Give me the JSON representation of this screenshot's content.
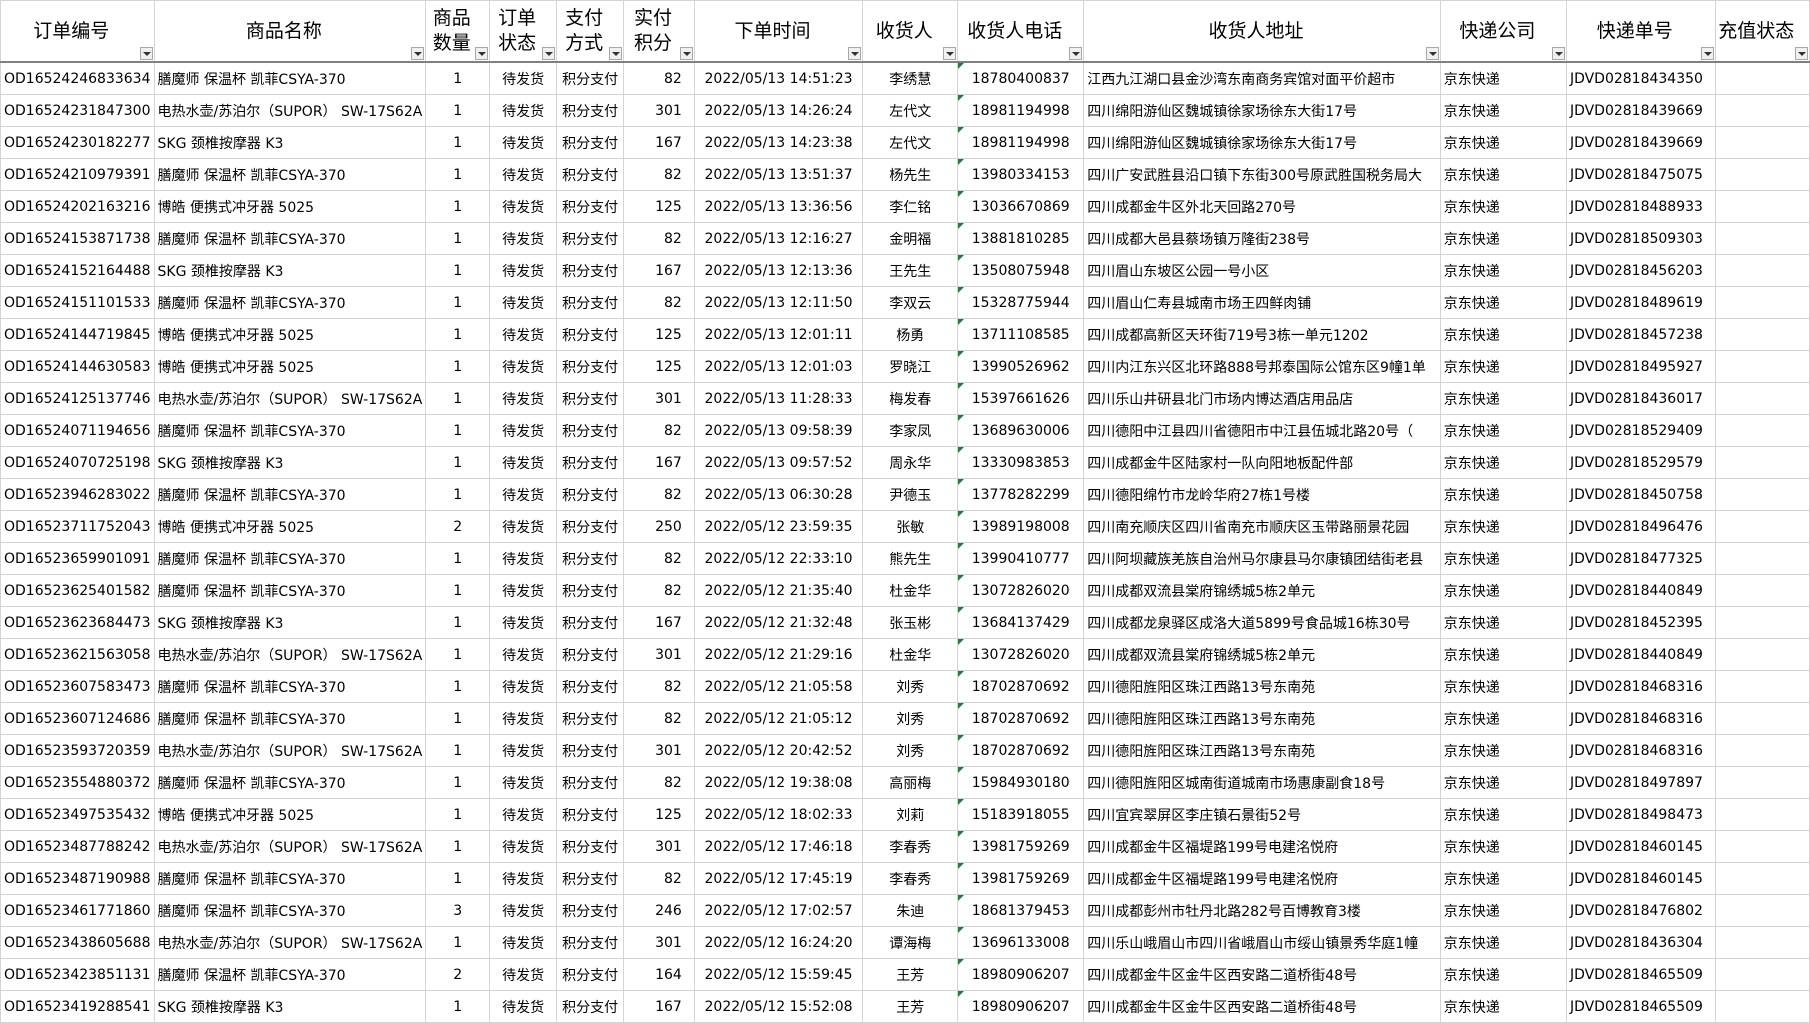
{
  "columns": [
    {
      "key": "id",
      "label": "订单编号",
      "align": "l"
    },
    {
      "key": "name",
      "label": "商品名称",
      "align": "l"
    },
    {
      "key": "qty",
      "label": "商品数量",
      "align": "c"
    },
    {
      "key": "status",
      "label": "订单状态",
      "align": "c"
    },
    {
      "key": "pay",
      "label": "支付方式",
      "align": "c"
    },
    {
      "key": "points",
      "label": "实付积分",
      "align": "r"
    },
    {
      "key": "time",
      "label": "下单时间",
      "align": "c"
    },
    {
      "key": "receiver",
      "label": "收货人",
      "align": "c"
    },
    {
      "key": "phone",
      "label": "收货人电话",
      "align": "c",
      "triangle": true
    },
    {
      "key": "addr",
      "label": "收货人地址",
      "align": "l"
    },
    {
      "key": "courier",
      "label": "快递公司",
      "align": "l"
    },
    {
      "key": "tracking",
      "label": "快递单号",
      "align": "l"
    },
    {
      "key": "recharge",
      "label": "充值状态",
      "align": "l"
    }
  ],
  "rows": [
    {
      "id": "OD16524246833634",
      "name": "膳魔师 保温杯 凯菲CSYA-370",
      "qty": "1",
      "status": "待发货",
      "pay": "积分支付",
      "points": "82",
      "time": "2022/05/13 14:51:23",
      "receiver": "李绣慧",
      "phone": "18780400837",
      "addr": "江西九江湖口县金沙湾东南商务宾馆对面平价超市",
      "courier": "京东快递",
      "tracking": "JDVD02818434350",
      "recharge": ""
    },
    {
      "id": "OD16524231847300",
      "name": "电热水壶/苏泊尔（SUPOR） SW-17S62A",
      "qty": "1",
      "status": "待发货",
      "pay": "积分支付",
      "points": "301",
      "time": "2022/05/13 14:26:24",
      "receiver": "左代文",
      "phone": "18981194998",
      "addr": "四川绵阳游仙区魏城镇徐家场徐东大街17号",
      "courier": "京东快递",
      "tracking": "JDVD02818439669",
      "recharge": ""
    },
    {
      "id": "OD16524230182277",
      "name": "SKG 颈椎按摩器 K3",
      "qty": "1",
      "status": "待发货",
      "pay": "积分支付",
      "points": "167",
      "time": "2022/05/13 14:23:38",
      "receiver": "左代文",
      "phone": "18981194998",
      "addr": "四川绵阳游仙区魏城镇徐家场徐东大街17号",
      "courier": "京东快递",
      "tracking": "JDVD02818439669",
      "recharge": ""
    },
    {
      "id": "OD16524210979391",
      "name": "膳魔师 保温杯 凯菲CSYA-370",
      "qty": "1",
      "status": "待发货",
      "pay": "积分支付",
      "points": "82",
      "time": "2022/05/13 13:51:37",
      "receiver": "杨先生",
      "phone": "13980334153",
      "addr": "四川广安武胜县沿口镇下东街300号原武胜国税务局大",
      "courier": "京东快递",
      "tracking": "JDVD02818475075",
      "recharge": ""
    },
    {
      "id": "OD16524202163216",
      "name": "博皓 便携式冲牙器 5025",
      "qty": "1",
      "status": "待发货",
      "pay": "积分支付",
      "points": "125",
      "time": "2022/05/13 13:36:56",
      "receiver": "李仁铭",
      "phone": "13036670869",
      "addr": "四川成都金牛区外北天回路270号",
      "courier": "京东快递",
      "tracking": "JDVD02818488933",
      "recharge": ""
    },
    {
      "id": "OD16524153871738",
      "name": "膳魔师 保温杯 凯菲CSYA-370",
      "qty": "1",
      "status": "待发货",
      "pay": "积分支付",
      "points": "82",
      "time": "2022/05/13 12:16:27",
      "receiver": "金明福",
      "phone": "13881810285",
      "addr": "四川成都大邑县蔡场镇万隆街238号",
      "courier": "京东快递",
      "tracking": "JDVD02818509303",
      "recharge": ""
    },
    {
      "id": "OD16524152164488",
      "name": "SKG 颈椎按摩器 K3",
      "qty": "1",
      "status": "待发货",
      "pay": "积分支付",
      "points": "167",
      "time": "2022/05/13 12:13:36",
      "receiver": "王先生",
      "phone": "13508075948",
      "addr": "四川眉山东坡区公园一号小区",
      "courier": "京东快递",
      "tracking": "JDVD02818456203",
      "recharge": ""
    },
    {
      "id": "OD16524151101533",
      "name": "膳魔师 保温杯 凯菲CSYA-370",
      "qty": "1",
      "status": "待发货",
      "pay": "积分支付",
      "points": "82",
      "time": "2022/05/13 12:11:50",
      "receiver": "李双云",
      "phone": "15328775944",
      "addr": "四川眉山仁寿县城南市场王四鲜肉铺",
      "courier": "京东快递",
      "tracking": "JDVD02818489619",
      "recharge": ""
    },
    {
      "id": "OD16524144719845",
      "name": "博皓 便携式冲牙器 5025",
      "qty": "1",
      "status": "待发货",
      "pay": "积分支付",
      "points": "125",
      "time": "2022/05/13 12:01:11",
      "receiver": "杨勇",
      "phone": "13711108585",
      "addr": "四川成都高新区天环街719号3栋一单元1202",
      "courier": "京东快递",
      "tracking": "JDVD02818457238",
      "recharge": ""
    },
    {
      "id": "OD16524144630583",
      "name": "博皓 便携式冲牙器 5025",
      "qty": "1",
      "status": "待发货",
      "pay": "积分支付",
      "points": "125",
      "time": "2022/05/13 12:01:03",
      "receiver": "罗晓江",
      "phone": "13990526962",
      "addr": "四川内江东兴区北环路888号邦泰国际公馆东区9幢1单",
      "courier": "京东快递",
      "tracking": "JDVD02818495927",
      "recharge": ""
    },
    {
      "id": "OD16524125137746",
      "name": "电热水壶/苏泊尔（SUPOR） SW-17S62A",
      "qty": "1",
      "status": "待发货",
      "pay": "积分支付",
      "points": "301",
      "time": "2022/05/13 11:28:33",
      "receiver": "梅发春",
      "phone": "15397661626",
      "addr": "四川乐山井研县北门市场内博达酒店用品店",
      "courier": "京东快递",
      "tracking": "JDVD02818436017",
      "recharge": ""
    },
    {
      "id": "OD16524071194656",
      "name": "膳魔师 保温杯 凯菲CSYA-370",
      "qty": "1",
      "status": "待发货",
      "pay": "积分支付",
      "points": "82",
      "time": "2022/05/13 09:58:39",
      "receiver": "李家凤",
      "phone": "13689630006",
      "addr": "四川德阳中江县四川省德阳市中江县伍城北路20号（",
      "courier": "京东快递",
      "tracking": "JDVD02818529409",
      "recharge": ""
    },
    {
      "id": "OD16524070725198",
      "name": "SKG 颈椎按摩器 K3",
      "qty": "1",
      "status": "待发货",
      "pay": "积分支付",
      "points": "167",
      "time": "2022/05/13 09:57:52",
      "receiver": "周永华",
      "phone": "13330983853",
      "addr": "四川成都金牛区陆家村一队向阳地板配件部",
      "courier": "京东快递",
      "tracking": "JDVD02818529579",
      "recharge": ""
    },
    {
      "id": "OD16523946283022",
      "name": "膳魔师 保温杯 凯菲CSYA-370",
      "qty": "1",
      "status": "待发货",
      "pay": "积分支付",
      "points": "82",
      "time": "2022/05/13 06:30:28",
      "receiver": "尹德玉",
      "phone": "13778282299",
      "addr": "四川德阳绵竹市龙岭华府27栋1号楼",
      "courier": "京东快递",
      "tracking": "JDVD02818450758",
      "recharge": ""
    },
    {
      "id": "OD16523711752043",
      "name": "博皓 便携式冲牙器 5025",
      "qty": "2",
      "status": "待发货",
      "pay": "积分支付",
      "points": "250",
      "time": "2022/05/12 23:59:35",
      "receiver": "张敏",
      "phone": "13989198008",
      "addr": "四川南充顺庆区四川省南充市顺庆区玉带路丽景花园",
      "courier": "京东快递",
      "tracking": "JDVD02818496476",
      "recharge": ""
    },
    {
      "id": "OD16523659901091",
      "name": "膳魔师 保温杯 凯菲CSYA-370",
      "qty": "1",
      "status": "待发货",
      "pay": "积分支付",
      "points": "82",
      "time": "2022/05/12 22:33:10",
      "receiver": "熊先生",
      "phone": "13990410777",
      "addr": "四川阿坝藏族羌族自治州马尔康县马尔康镇团结街老县",
      "courier": "京东快递",
      "tracking": "JDVD02818477325",
      "recharge": ""
    },
    {
      "id": "OD16523625401582",
      "name": "膳魔师 保温杯 凯菲CSYA-370",
      "qty": "1",
      "status": "待发货",
      "pay": "积分支付",
      "points": "82",
      "time": "2022/05/12 21:35:40",
      "receiver": "杜金华",
      "phone": "13072826020",
      "addr": "四川成都双流县棠府锦绣城5栋2单元",
      "courier": "京东快递",
      "tracking": "JDVD02818440849",
      "recharge": ""
    },
    {
      "id": "OD16523623684473",
      "name": "SKG 颈椎按摩器 K3",
      "qty": "1",
      "status": "待发货",
      "pay": "积分支付",
      "points": "167",
      "time": "2022/05/12 21:32:48",
      "receiver": "张玉彬",
      "phone": "13684137429",
      "addr": "四川成都龙泉驿区成洛大道5899号食品城16栋30号",
      "courier": "京东快递",
      "tracking": "JDVD02818452395",
      "recharge": ""
    },
    {
      "id": "OD16523621563058",
      "name": "电热水壶/苏泊尔（SUPOR） SW-17S62A",
      "qty": "1",
      "status": "待发货",
      "pay": "积分支付",
      "points": "301",
      "time": "2022/05/12 21:29:16",
      "receiver": "杜金华",
      "phone": "13072826020",
      "addr": "四川成都双流县棠府锦绣城5栋2单元",
      "courier": "京东快递",
      "tracking": "JDVD02818440849",
      "recharge": ""
    },
    {
      "id": "OD16523607583473",
      "name": "膳魔师 保温杯 凯菲CSYA-370",
      "qty": "1",
      "status": "待发货",
      "pay": "积分支付",
      "points": "82",
      "time": "2022/05/12 21:05:58",
      "receiver": "刘秀",
      "phone": "18702870692",
      "addr": "四川德阳旌阳区珠江西路13号东南苑",
      "courier": "京东快递",
      "tracking": "JDVD02818468316",
      "recharge": ""
    },
    {
      "id": "OD16523607124686",
      "name": "膳魔师 保温杯 凯菲CSYA-370",
      "qty": "1",
      "status": "待发货",
      "pay": "积分支付",
      "points": "82",
      "time": "2022/05/12 21:05:12",
      "receiver": "刘秀",
      "phone": "18702870692",
      "addr": "四川德阳旌阳区珠江西路13号东南苑",
      "courier": "京东快递",
      "tracking": "JDVD02818468316",
      "recharge": ""
    },
    {
      "id": "OD16523593720359",
      "name": "电热水壶/苏泊尔（SUPOR） SW-17S62A",
      "qty": "1",
      "status": "待发货",
      "pay": "积分支付",
      "points": "301",
      "time": "2022/05/12 20:42:52",
      "receiver": "刘秀",
      "phone": "18702870692",
      "addr": "四川德阳旌阳区珠江西路13号东南苑",
      "courier": "京东快递",
      "tracking": "JDVD02818468316",
      "recharge": ""
    },
    {
      "id": "OD16523554880372",
      "name": "膳魔师 保温杯 凯菲CSYA-370",
      "qty": "1",
      "status": "待发货",
      "pay": "积分支付",
      "points": "82",
      "time": "2022/05/12 19:38:08",
      "receiver": "高丽梅",
      "phone": "15984930180",
      "addr": "四川德阳旌阳区城南街道城南市场惠康副食18号",
      "courier": "京东快递",
      "tracking": "JDVD02818497897",
      "recharge": ""
    },
    {
      "id": "OD16523497535432",
      "name": "博皓 便携式冲牙器 5025",
      "qty": "1",
      "status": "待发货",
      "pay": "积分支付",
      "points": "125",
      "time": "2022/05/12 18:02:33",
      "receiver": "刘莉",
      "phone": "15183918055",
      "addr": "四川宜宾翠屏区李庄镇石景街52号",
      "courier": "京东快递",
      "tracking": "JDVD02818498473",
      "recharge": ""
    },
    {
      "id": "OD16523487788242",
      "name": "电热水壶/苏泊尔（SUPOR） SW-17S62A",
      "qty": "1",
      "status": "待发货",
      "pay": "积分支付",
      "points": "301",
      "time": "2022/05/12 17:46:18",
      "receiver": "李春秀",
      "phone": "13981759269",
      "addr": "四川成都金牛区福堤路199号电建洺悦府",
      "courier": "京东快递",
      "tracking": "JDVD02818460145",
      "recharge": ""
    },
    {
      "id": "OD16523487190988",
      "name": "膳魔师 保温杯 凯菲CSYA-370",
      "qty": "1",
      "status": "待发货",
      "pay": "积分支付",
      "points": "82",
      "time": "2022/05/12 17:45:19",
      "receiver": "李春秀",
      "phone": "13981759269",
      "addr": "四川成都金牛区福堤路199号电建洺悦府",
      "courier": "京东快递",
      "tracking": "JDVD02818460145",
      "recharge": ""
    },
    {
      "id": "OD16523461771860",
      "name": "膳魔师 保温杯 凯菲CSYA-370",
      "qty": "3",
      "status": "待发货",
      "pay": "积分支付",
      "points": "246",
      "time": "2022/05/12 17:02:57",
      "receiver": "朱迪",
      "phone": "18681379453",
      "addr": "四川成都彭州市牡丹北路282号百博教育3楼",
      "courier": "京东快递",
      "tracking": "JDVD02818476802",
      "recharge": ""
    },
    {
      "id": "OD16523438605688",
      "name": "电热水壶/苏泊尔（SUPOR） SW-17S62A",
      "qty": "1",
      "status": "待发货",
      "pay": "积分支付",
      "points": "301",
      "time": "2022/05/12 16:24:20",
      "receiver": "谭海梅",
      "phone": "13696133008",
      "addr": "四川乐山峨眉山市四川省峨眉山市绥山镇景秀华庭1幢",
      "courier": "京东快递",
      "tracking": "JDVD02818436304",
      "recharge": ""
    },
    {
      "id": "OD16523423851131",
      "name": "膳魔师 保温杯 凯菲CSYA-370",
      "qty": "2",
      "status": "待发货",
      "pay": "积分支付",
      "points": "164",
      "time": "2022/05/12 15:59:45",
      "receiver": "王芳",
      "phone": "18980906207",
      "addr": "四川成都金牛区金牛区西安路二道桥街48号",
      "courier": "京东快递",
      "tracking": "JDVD02818465509",
      "recharge": ""
    },
    {
      "id": "OD16523419288541",
      "name": "SKG 颈椎按摩器 K3",
      "qty": "1",
      "status": "待发货",
      "pay": "积分支付",
      "points": "167",
      "time": "2022/05/12 15:52:08",
      "receiver": "王芳",
      "phone": "18980906207",
      "addr": "四川成都金牛区金牛区西安路二道桥街48号",
      "courier": "京东快递",
      "tracking": "JDVD02818465509",
      "recharge": ""
    }
  ]
}
